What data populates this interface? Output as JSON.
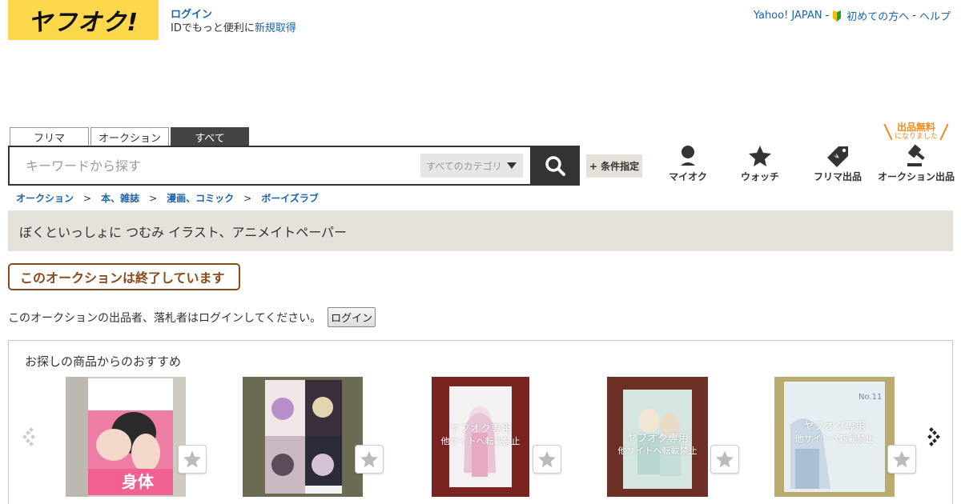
{
  "header": {
    "logo_text": "ヤフオク!",
    "login_link": "ログイン",
    "login_sub_prefix": "IDでもっと便利に",
    "register_link": "新規取得",
    "top_links": {
      "yahoo_japan": "Yahoo! JAPAN",
      "first_time": "初めての方へ",
      "help": "ヘルプ",
      "sep": "-"
    }
  },
  "search": {
    "tabs": [
      "フリマ",
      "オークション",
      "すべて"
    ],
    "active_tab": "すべて",
    "placeholder": "キーワードから探す",
    "category_value": "すべてのカテゴリ",
    "condition_button": "+ 条件指定"
  },
  "nav": {
    "my_auction": "マイオク",
    "watch": "ウォッチ",
    "flea_listing": "フリマ出品",
    "auction_listing": "オークション出品",
    "free_badge_big": "出品無料",
    "free_badge_small": "になりました"
  },
  "breadcrumb": [
    "オークション",
    "本、雑誌",
    "漫画、コミック",
    "ボーイズラブ"
  ],
  "breadcrumb_sep": ">",
  "item": {
    "title": "ぼくといっしょに つむみ イラスト、アニメイトペーパー",
    "ended_label": "このオークションは終了しています",
    "login_note": "このオークションの出品者、落札者はログインしてください。",
    "login_button": "ログイン"
  },
  "recommend": {
    "title": "お探しの商品からのおすすめ",
    "watermark_line1": "ヤフオク専用",
    "watermark_line2": "他サイトへ転載禁止",
    "items": [
      {
        "name": "bl-comic-pink-cover",
        "cover_text": "身体"
      },
      {
        "name": "manga-set-cover"
      },
      {
        "name": "illustration-paper-1"
      },
      {
        "name": "illustration-paper-2"
      },
      {
        "name": "illustration-paper-3"
      }
    ]
  },
  "colors": {
    "logo_bg": "#fcd84a",
    "link": "#1c64ab",
    "ended_border": "#8a4a1e",
    "title_bg": "#e4e2db",
    "free_badge": "#f08c1e"
  }
}
